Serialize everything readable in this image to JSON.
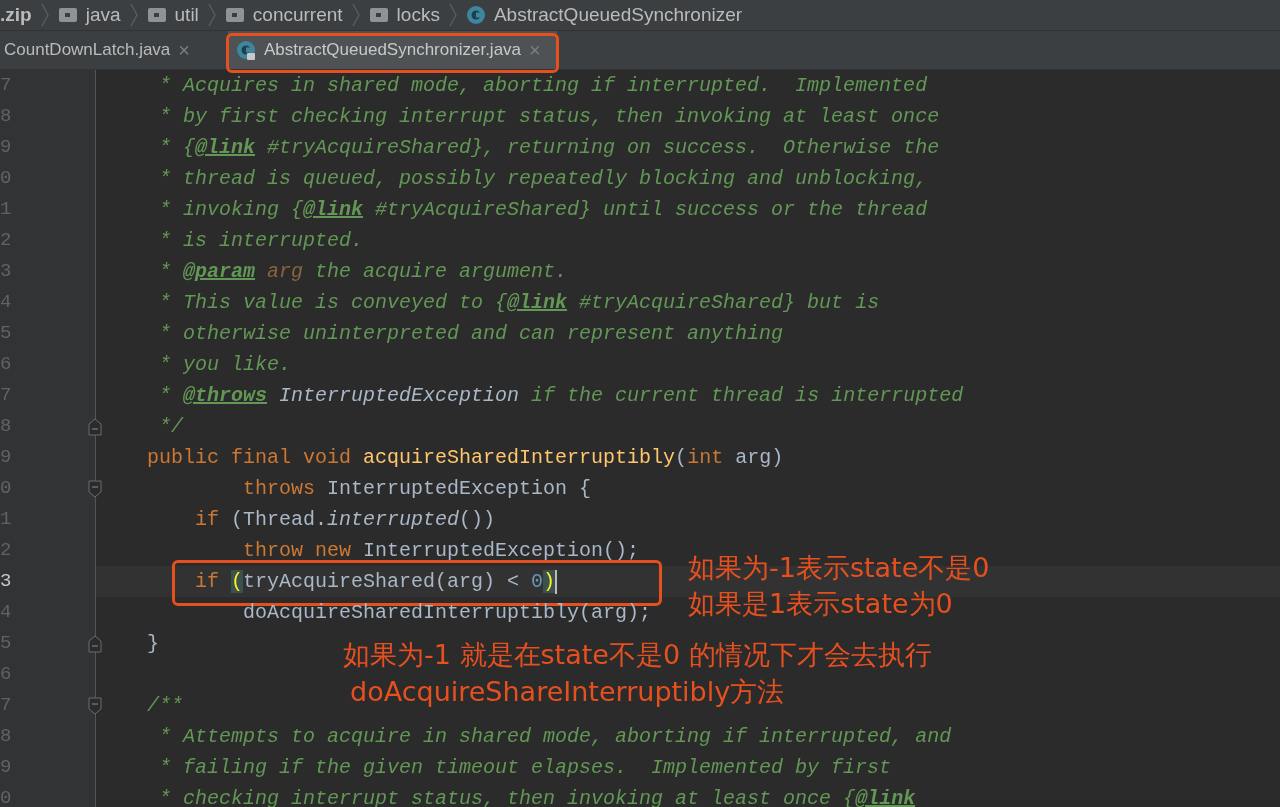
{
  "breadcrumbs": [
    {
      "text": ".zip",
      "kind": "module"
    },
    {
      "text": "java",
      "kind": "folder"
    },
    {
      "text": "util",
      "kind": "folder"
    },
    {
      "text": "concurrent",
      "kind": "folder"
    },
    {
      "text": "locks",
      "kind": "folder"
    },
    {
      "text": "AbstractQueuedSynchronizer",
      "kind": "class"
    }
  ],
  "tabs": [
    {
      "label": "CountDownLatch.java",
      "selected": false,
      "kind": "plain",
      "close": "×",
      "circled": false
    },
    {
      "label": "AbstractQueuedSynchronizer.java",
      "selected": true,
      "kind": "class",
      "close": "×",
      "circled": true
    }
  ],
  "editor": {
    "lines": [
      {
        "number": "7",
        "current": false,
        "kind": "line",
        "segments": [
          {
            "kind": "comment",
            "text": " * Acquires in shared mode, aborting if interrupted.  Implemented"
          }
        ]
      },
      {
        "number": "8",
        "current": false,
        "kind": "line",
        "segments": [
          {
            "kind": "comment",
            "text": " * by first checking interrupt status, then invoking at least once"
          }
        ]
      },
      {
        "number": "9",
        "current": false,
        "kind": "line",
        "segments": [
          {
            "kind": "comment",
            "text": " * {"
          },
          {
            "kind": "doc-tag",
            "text": "@link"
          },
          {
            "kind": "comment",
            "text": " #tryAcquireShared}, returning on success.  Otherwise the"
          }
        ]
      },
      {
        "number": "0",
        "current": false,
        "kind": "line",
        "segments": [
          {
            "kind": "comment",
            "text": " * thread is queued, possibly repeatedly blocking and unblocking,"
          }
        ]
      },
      {
        "number": "1",
        "current": false,
        "kind": "line",
        "segments": [
          {
            "kind": "comment",
            "text": " * invoking {"
          },
          {
            "kind": "doc-tag",
            "text": "@link"
          },
          {
            "kind": "comment",
            "text": " #tryAcquireShared} until success or the thread"
          }
        ]
      },
      {
        "number": "2",
        "current": false,
        "kind": "line",
        "segments": [
          {
            "kind": "comment",
            "text": " * is interrupted."
          }
        ]
      },
      {
        "number": "3",
        "current": false,
        "kind": "line",
        "segments": [
          {
            "kind": "comment",
            "text": " * "
          },
          {
            "kind": "doc-tag",
            "text": "@param"
          },
          {
            "kind": "doc-param",
            "text": " arg"
          },
          {
            "kind": "comment",
            "text": " the acquire argument."
          }
        ]
      },
      {
        "number": "4",
        "current": false,
        "kind": "line",
        "segments": [
          {
            "kind": "comment",
            "text": " * This value is conveyed to {"
          },
          {
            "kind": "doc-tag",
            "text": "@link"
          },
          {
            "kind": "comment",
            "text": " #tryAcquireShared} but is"
          }
        ]
      },
      {
        "number": "5",
        "current": false,
        "kind": "line",
        "segments": [
          {
            "kind": "comment",
            "text": " * otherwise uninterpreted and can represent anything"
          }
        ]
      },
      {
        "number": "6",
        "current": false,
        "kind": "line",
        "segments": [
          {
            "kind": "comment",
            "text": " * you like."
          }
        ]
      },
      {
        "number": "7",
        "current": false,
        "kind": "line",
        "segments": [
          {
            "kind": "comment",
            "text": " * "
          },
          {
            "kind": "doc-tag",
            "text": "@throws"
          },
          {
            "kind": "doc-type",
            "text": " InterruptedException"
          },
          {
            "kind": "comment",
            "text": " if the current thread is interrupted"
          }
        ]
      },
      {
        "number": "8",
        "current": false,
        "kind": "fold-end",
        "segments": [
          {
            "kind": "comment",
            "text": " */"
          }
        ]
      },
      {
        "number": "9",
        "current": false,
        "kind": "line",
        "segments": [
          {
            "kind": "keyword",
            "text": "public final void "
          },
          {
            "kind": "method",
            "text": "acquireSharedInterruptibly"
          },
          {
            "kind": "plain",
            "text": "("
          },
          {
            "kind": "keyword",
            "text": "int "
          },
          {
            "kind": "plain",
            "text": "arg)"
          }
        ]
      },
      {
        "number": "0",
        "current": false,
        "kind": "fold-start",
        "segments": [
          {
            "kind": "keyword",
            "text": "        throws "
          },
          {
            "kind": "plain",
            "text": "InterruptedException {"
          }
        ]
      },
      {
        "number": "1",
        "current": false,
        "kind": "line",
        "segments": [
          {
            "kind": "keyword",
            "text": "    if "
          },
          {
            "kind": "plain",
            "text": "(Thread."
          },
          {
            "kind": "italic",
            "text": "interrupted"
          },
          {
            "kind": "plain",
            "text": "())"
          }
        ]
      },
      {
        "number": "2",
        "current": false,
        "kind": "line",
        "segments": [
          {
            "kind": "keyword",
            "text": "        throw new "
          },
          {
            "kind": "plain",
            "text": "InterruptedException();"
          }
        ]
      },
      {
        "number": "3",
        "current": true,
        "circled": true,
        "kind": "line",
        "segments": [
          {
            "kind": "keyword",
            "text": "    if "
          },
          {
            "kind": "brace",
            "text": "("
          },
          {
            "kind": "plain",
            "text": "tryAcquireShared(arg) < "
          },
          {
            "kind": "number",
            "text": "0"
          },
          {
            "kind": "brace",
            "text": ")"
          }
        ]
      },
      {
        "number": "4",
        "current": false,
        "kind": "line",
        "segments": [
          {
            "kind": "plain",
            "text": "        doAcquireSharedInterruptibly(arg);"
          }
        ]
      },
      {
        "number": "5",
        "current": false,
        "kind": "fold-end",
        "segments": [
          {
            "kind": "plain",
            "text": "}"
          }
        ]
      },
      {
        "number": "6",
        "current": false,
        "kind": "line"
      },
      {
        "number": "7",
        "current": false,
        "kind": "fold-start",
        "segments": [
          {
            "kind": "comment",
            "text": "/**"
          }
        ]
      },
      {
        "number": "8",
        "current": false,
        "kind": "line",
        "segments": [
          {
            "kind": "comment",
            "text": " * Attempts to acquire in shared mode, aborting if interrupted, and"
          }
        ]
      },
      {
        "number": "9",
        "current": false,
        "kind": "line",
        "segments": [
          {
            "kind": "comment",
            "text": " * failing if the given timeout elapses.  Implemented by first"
          }
        ]
      },
      {
        "number": "0",
        "current": false,
        "kind": "line",
        "segments": [
          {
            "kind": "comment",
            "text": " * checking interrupt status, then invoking at least once {"
          },
          {
            "kind": "doc-tag",
            "text": "@link"
          }
        ]
      }
    ]
  },
  "notes": [
    {
      "kind": "beside",
      "text": "如果为-1表示state不是0"
    },
    {
      "kind": "beside2",
      "text": "如果是1表示state为0"
    },
    {
      "kind": "below",
      "text": "如果为-1 就是在state不是0 的情况下才会去执行"
    },
    {
      "kind": "below2",
      "text": "doAcquireShareInterruptibly方法"
    }
  ]
}
